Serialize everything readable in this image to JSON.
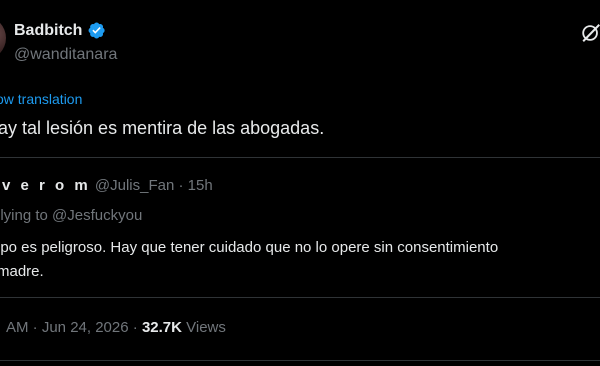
{
  "author": {
    "display_name": "Badbitch",
    "handle": "@wanditanara",
    "verified": true,
    "verified_color": "#1d9bf0"
  },
  "post": {
    "translation_link": "ow translation",
    "text": "ay tal lesión es mentira de las abogadas."
  },
  "quoted_post": {
    "author_name": "v e r o m",
    "handle": "@Julis_Fan",
    "separator": "·",
    "time": "15h",
    "replying_to": "plying to @Jesfuckyou",
    "text_line1": "ipo es peligroso. Hay que tener cuidado que no lo opere sin consentimiento",
    "text_line2": "madre."
  },
  "meta": {
    "time": "AM",
    "separator": "·",
    "date": "Jun 24, 2026",
    "views_count": "32.7K",
    "views_label": "Views"
  },
  "icons": {
    "verified": "verified-badge-icon",
    "grok": "grok-icon"
  },
  "colors": {
    "background": "#000000",
    "primary_text": "#e7e9ea",
    "secondary_text": "#71767b",
    "link": "#1d9bf0",
    "border": "#2f3336"
  }
}
